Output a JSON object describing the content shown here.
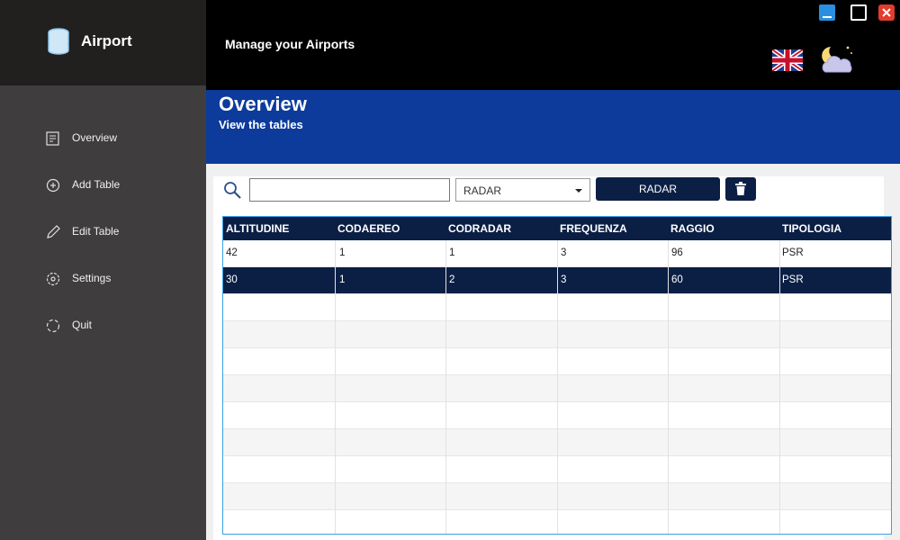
{
  "sidebar": {
    "brand": "Airport",
    "items": [
      {
        "label": "Overview",
        "icon": "overview-icon"
      },
      {
        "label": "Add Table",
        "icon": "add-icon"
      },
      {
        "label": "Edit Table",
        "icon": "pencil-icon"
      },
      {
        "label": "Settings",
        "icon": "gear-icon"
      },
      {
        "label": "Quit",
        "icon": "quit-icon"
      }
    ]
  },
  "topbar": {
    "title": "Manage your Airports"
  },
  "header": {
    "title": "Overview",
    "subtitle": "View the tables"
  },
  "toolbar": {
    "search_value": "",
    "table_select": "RADAR",
    "action_label": "RADAR"
  },
  "grid": {
    "columns": [
      "ALTITUDINE",
      "CODAEREO",
      "CODRADAR",
      "FREQUENZA",
      "RAGGIO",
      "TIPOLOGIA"
    ],
    "rows": [
      [
        "42",
        "1",
        "1",
        "3",
        "96",
        "PSR"
      ],
      [
        "30",
        "1",
        "2",
        "3",
        "60",
        "PSR"
      ]
    ],
    "selected_row": 1
  },
  "colors": {
    "sidebar_bg": "#403d3f",
    "brand_bg": "#221f1f",
    "header_bg": "#0c3b9b",
    "accent_dark": "#0b1f45",
    "grid_border": "#3aa0e8"
  }
}
